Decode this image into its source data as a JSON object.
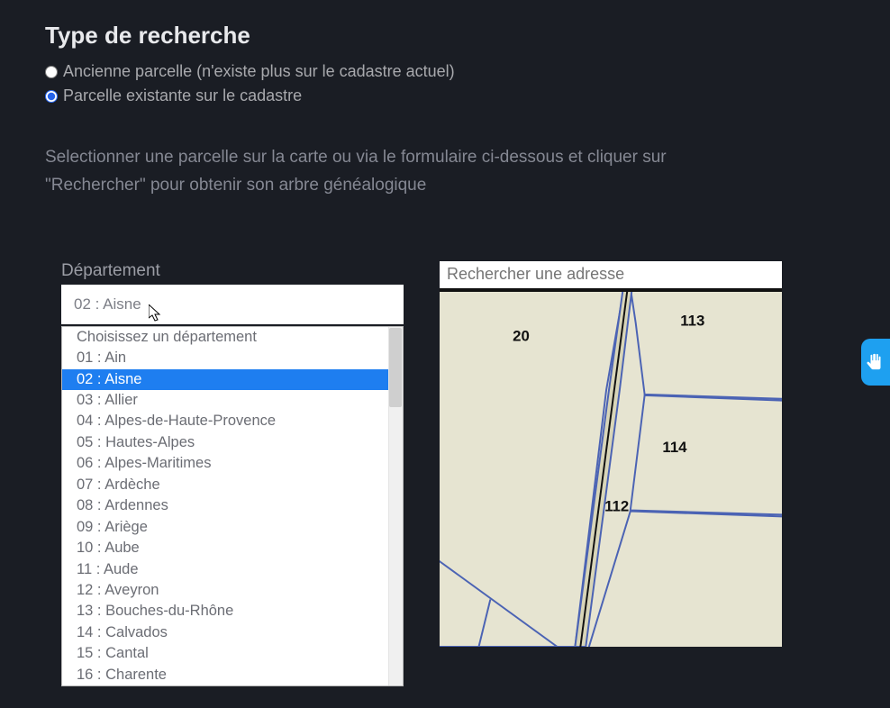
{
  "title": "Type de recherche",
  "radios": {
    "old_label": "Ancienne parcelle (n'existe plus sur le cadastre actuel)",
    "current_label": "Parcelle existante sur le cadastre"
  },
  "instructions": "Selectionner une parcelle sur la carte ou via le formulaire ci-dessous et cliquer sur \"Rechercher\" pour obtenir son arbre généalogique",
  "department": {
    "label": "Département",
    "value": "02 : Aisne",
    "placeholder_option": "Choisissez un département",
    "options": [
      "01 : Ain",
      "02 : Aisne",
      "03 : Allier",
      "04 : Alpes-de-Haute-Provence",
      "05 : Hautes-Alpes",
      "06 : Alpes-Maritimes",
      "07 : Ardèche",
      "08 : Ardennes",
      "09 : Ariège",
      "10 : Aube",
      "11 : Aude",
      "12 : Aveyron",
      "13 : Bouches-du-Rhône",
      "14 : Calvados",
      "15 : Cantal",
      "16 : Charente"
    ],
    "highlighted_index": 1
  },
  "address_search": {
    "placeholder": "Rechercher une adresse"
  },
  "map": {
    "parcels": [
      {
        "id": "20"
      },
      {
        "id": "113"
      },
      {
        "id": "114"
      },
      {
        "id": "112"
      }
    ]
  }
}
